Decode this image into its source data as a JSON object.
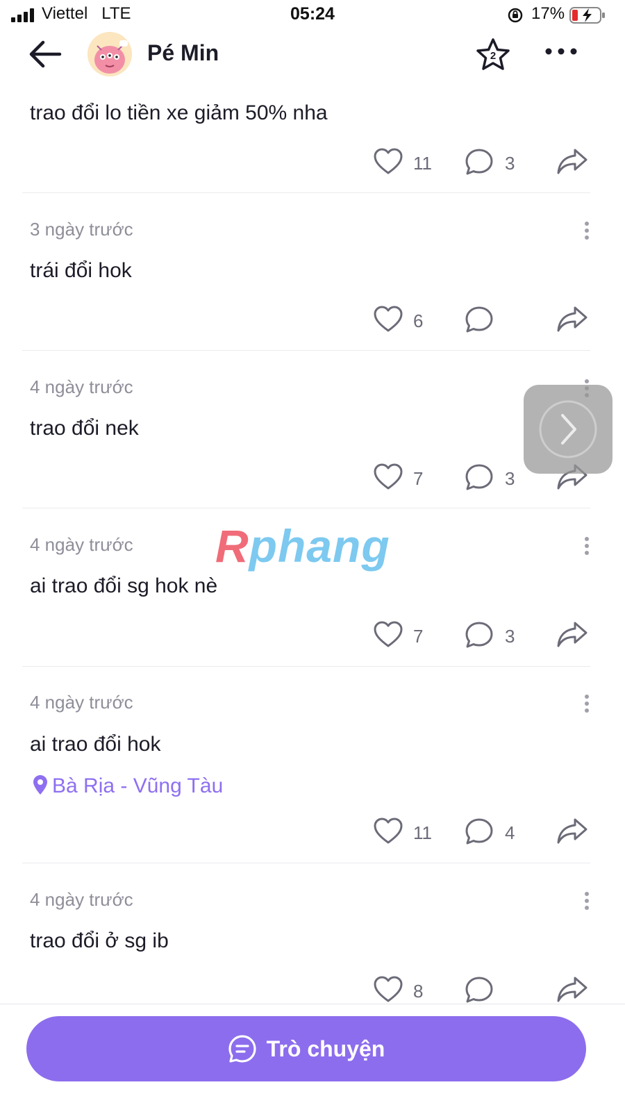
{
  "status_bar": {
    "carrier": "Viettel",
    "network": "LTE",
    "time": "05:24",
    "battery": "17%"
  },
  "header": {
    "name": "Pé Min",
    "star_badge": "2"
  },
  "posts": [
    {
      "date": "",
      "text": "trao đổi lo tiền xe giảm 50% nha",
      "location": "",
      "likes": "11",
      "comments": "3"
    },
    {
      "date": "3 ngày trước",
      "text": "trái đổi hok",
      "location": "",
      "likes": "6",
      "comments": ""
    },
    {
      "date": "4 ngày trước",
      "text": "trao đổi nek",
      "location": "",
      "likes": "7",
      "comments": "3"
    },
    {
      "date": "4 ngày trước",
      "text": "ai trao đổi sg hok nè",
      "location": "",
      "likes": "7",
      "comments": "3"
    },
    {
      "date": "4 ngày trước",
      "text": "ai trao đổi hok",
      "location": "Bà Rịa - Vũng Tàu",
      "likes": "11",
      "comments": "4"
    },
    {
      "date": "4 ngày trước",
      "text": "trao đổi ở sg ib",
      "location": "",
      "likes": "8",
      "comments": ""
    }
  ],
  "watermark": {
    "first": "R",
    "rest": "phang"
  },
  "chat_button": {
    "label": "Trò chuyện"
  },
  "colors": {
    "accent": "#8c6ded",
    "location": "#8e6ff0",
    "muted": "#8e8e99"
  }
}
